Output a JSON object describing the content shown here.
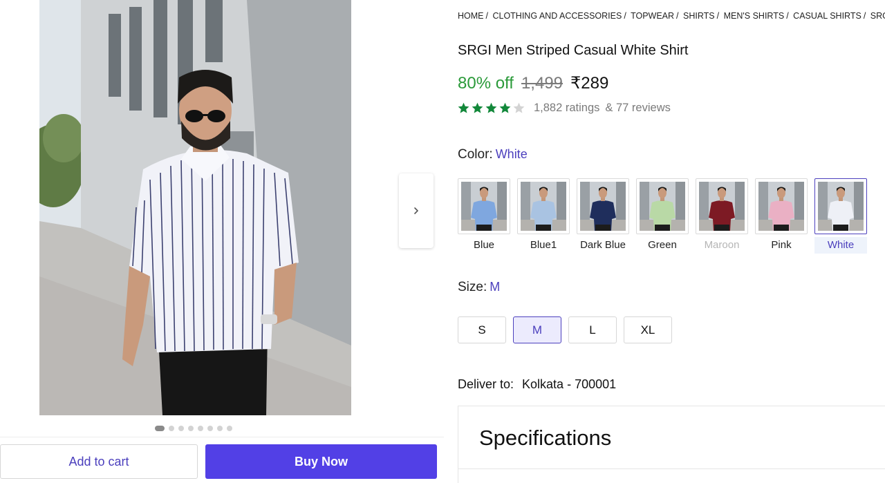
{
  "gallery": {
    "next_icon": "chevron-right-icon",
    "dot_count": 8,
    "active_dot": 1
  },
  "actions": {
    "add_to_cart": "Add to cart",
    "buy_now": "Buy Now"
  },
  "breadcrumb": [
    "HOME",
    "CLOTHING AND ACCESSORIES",
    "TOPWEAR",
    "SHIRTS",
    "MEN'S SHIRTS",
    "CASUAL SHIRTS",
    "SRGI C"
  ],
  "product": {
    "title": "SRGI Men Striped Casual White Shirt",
    "discount": "80% off",
    "mrp": "1,499",
    "price": "₹289",
    "rating_value": 4,
    "rating_max": 5,
    "ratings": "1,882 ratings",
    "reviews": "& 77 reviews"
  },
  "color": {
    "label": "Color:",
    "selected": "White",
    "options": [
      {
        "name": "Blue",
        "state": "normal",
        "shirt": "#7fa7df"
      },
      {
        "name": "Blue1",
        "state": "normal",
        "shirt": "#a9c3e2"
      },
      {
        "name": "Dark Blue",
        "state": "normal",
        "shirt": "#1f2e5c"
      },
      {
        "name": "Green",
        "state": "normal",
        "shirt": "#b9d9a6"
      },
      {
        "name": "Maroon",
        "state": "disabled",
        "shirt": "#7d1a24"
      },
      {
        "name": "Pink",
        "state": "normal",
        "shirt": "#eab0c4"
      },
      {
        "name": "White",
        "state": "selected",
        "shirt": "#eef0f6"
      }
    ]
  },
  "size": {
    "label": "Size:",
    "selected": "M",
    "options": [
      "S",
      "M",
      "L",
      "XL"
    ]
  },
  "delivery": {
    "label": "Deliver to:",
    "location": "Kolkata - 700001"
  },
  "specifications": {
    "title": "Specifications"
  },
  "colors": {
    "accent": "#4b3fbd",
    "buy_button": "#5240e6",
    "discount": "#2b9a3a",
    "star_filled": "#12883a",
    "star_empty": "#d3d3d3"
  }
}
